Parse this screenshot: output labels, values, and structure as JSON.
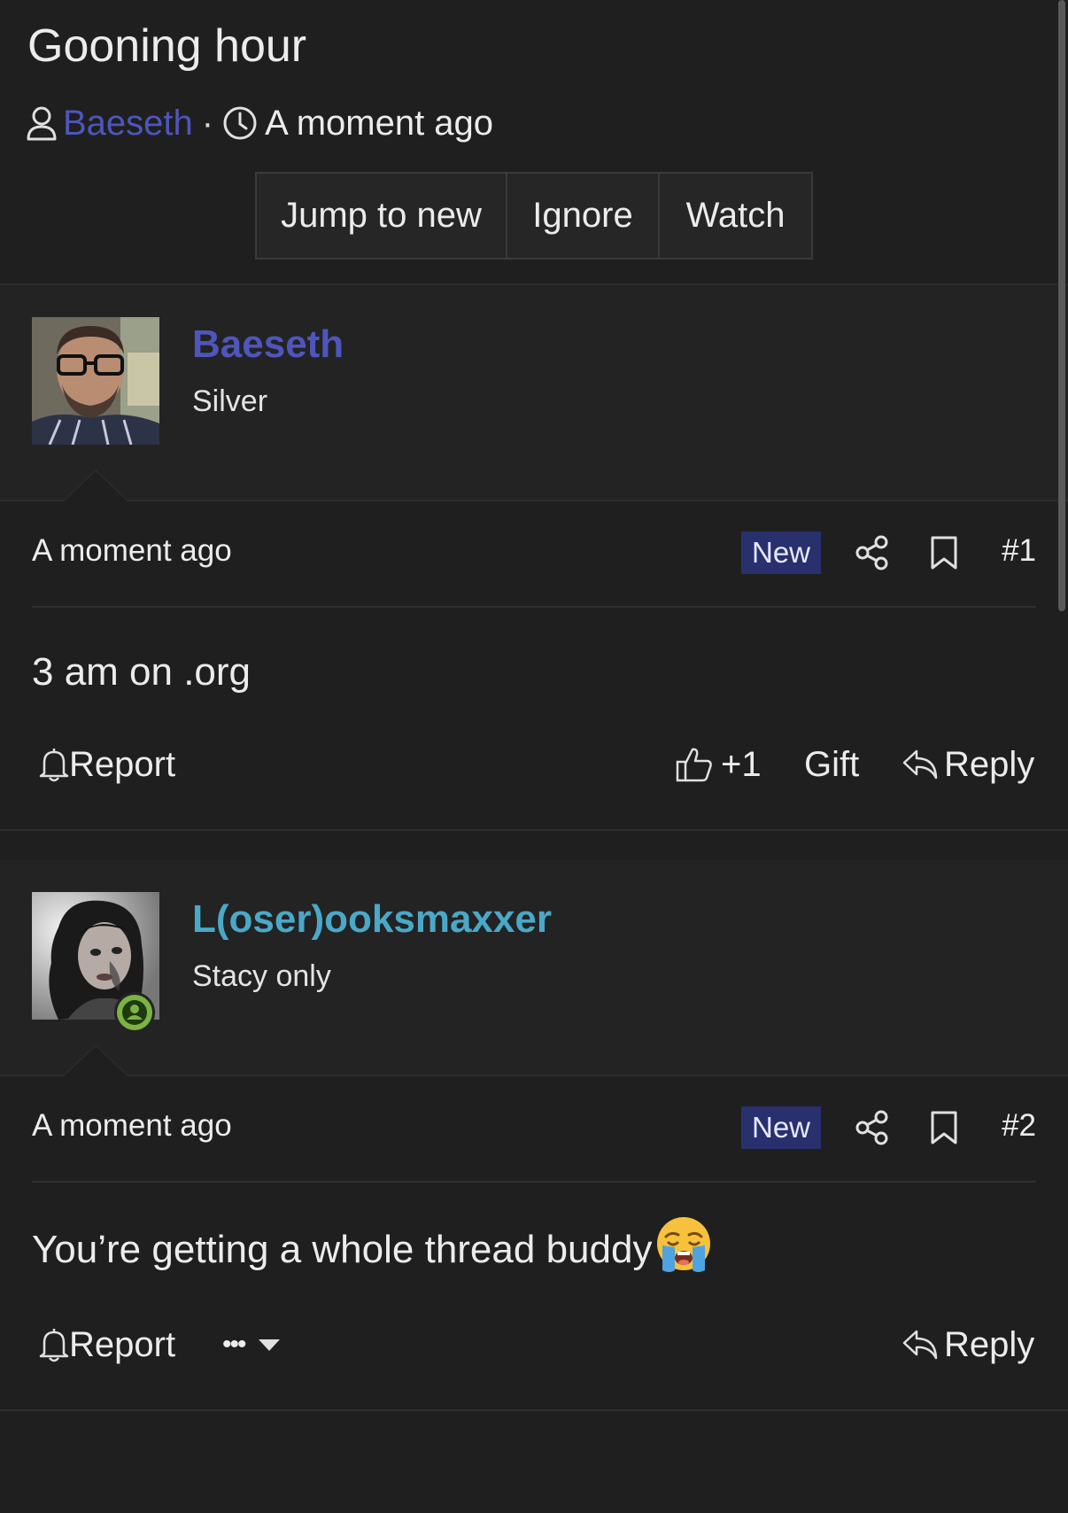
{
  "thread": {
    "title": "Gooning hour",
    "author": "Baeseth",
    "separator": "·",
    "time": "A moment ago",
    "actions": {
      "jump_to_new": "Jump to new",
      "ignore": "Ignore",
      "watch": "Watch"
    }
  },
  "posts": [
    {
      "username": "Baeseth",
      "username_color": "#4e56bd",
      "user_title": "Silver",
      "date": "A moment ago",
      "badge": "New",
      "number": "#1",
      "body": "3 am on .org",
      "footer": {
        "report": "Report",
        "like": "+1",
        "gift": "Gift",
        "reply": "Reply"
      }
    },
    {
      "username": "L(oser)ooksmaxxer",
      "username_color": "#4aa8c8",
      "user_title": "Stacy only",
      "date": "A moment ago",
      "badge": "New",
      "number": "#2",
      "body": "You’re getting a whole thread buddy",
      "body_emoji": "😭",
      "online": true,
      "footer": {
        "report": "Report",
        "more": "•••",
        "reply": "Reply"
      }
    }
  ],
  "colors": {
    "background": "#1f1f1f",
    "accent": "#4e56bd",
    "badge_new": "#28306e",
    "online": "#7cb342"
  }
}
